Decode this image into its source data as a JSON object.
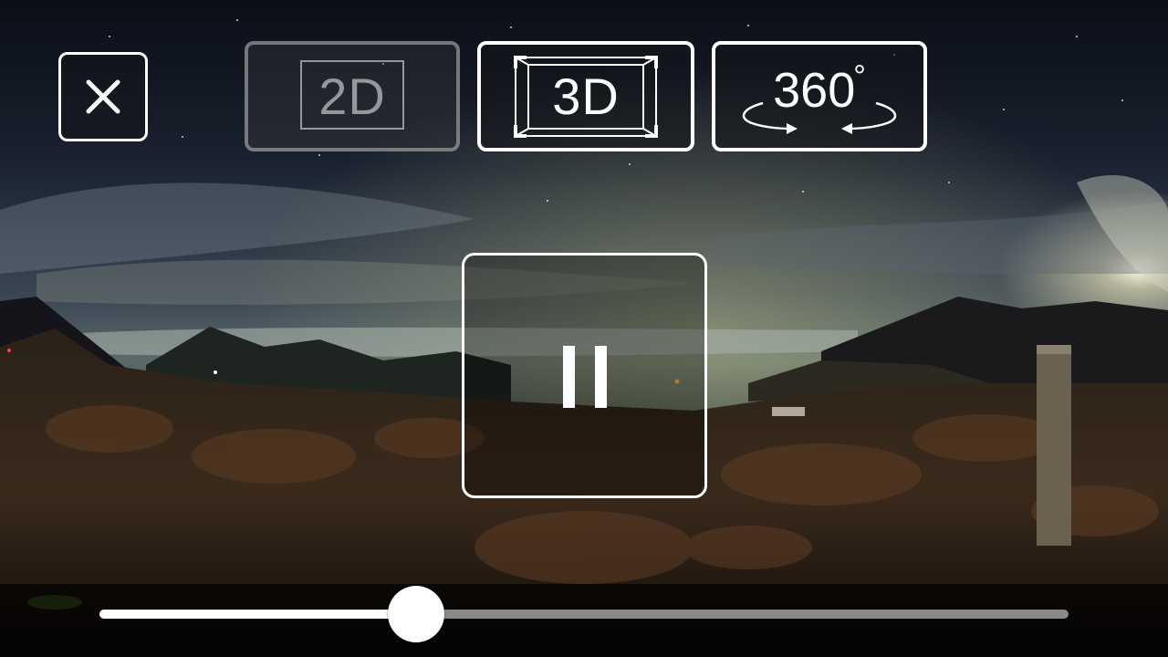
{
  "controls": {
    "close_icon": "close-icon",
    "view_modes": [
      {
        "label": "2D",
        "active": false
      },
      {
        "label": "3D",
        "active": true
      },
      {
        "label": "360",
        "degree_symbol": "°",
        "active": false
      }
    ],
    "playback_state": "playing",
    "pause_icon": "pause-icon"
  },
  "seek": {
    "progress": 0.327
  },
  "colors": {
    "control_border": "#ffffff",
    "inactive_border": "#bebebe",
    "track_played": "#ffffff",
    "track_remaining": "#8a8a8a"
  }
}
